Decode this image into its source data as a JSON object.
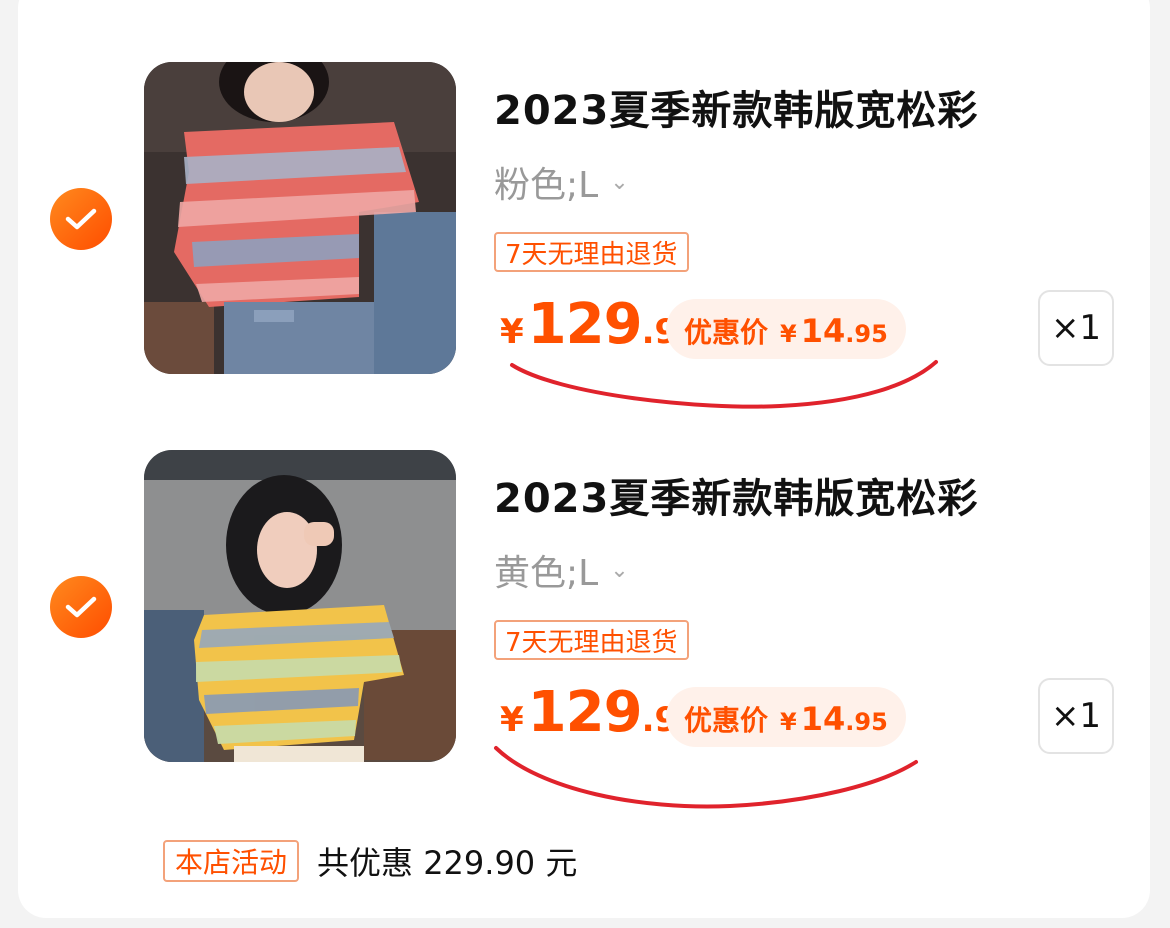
{
  "items": [
    {
      "title": "2023夏季新款韩版宽松彩",
      "variant": "粉色;L",
      "return_tag": "7天无理由退货",
      "price_symbol": "¥",
      "price_int": "129",
      "price_dec": ".9",
      "promo_label": "优惠价",
      "promo_symbol": "¥",
      "promo_int": "14",
      "promo_dec": ".95",
      "quantity": "×1",
      "selected": true,
      "stripe_colors": [
        "#e46a63",
        "#a9b2c6",
        "#f0a8a5",
        "#8fa0bd"
      ]
    },
    {
      "title": "2023夏季新款韩版宽松彩",
      "variant": "黄色;L",
      "return_tag": "7天无理由退货",
      "price_symbol": "¥",
      "price_int": "129",
      "price_dec": ".9",
      "promo_label": "优惠价",
      "promo_symbol": "¥",
      "promo_int": "14",
      "promo_dec": ".95",
      "quantity": "×1",
      "selected": true,
      "stripe_colors": [
        "#f2c34a",
        "#9aa9b6",
        "#c9dba6",
        "#8d9cb0"
      ]
    }
  ],
  "footer": {
    "tag": "本店活动",
    "text": "共优惠 229.90 元"
  },
  "colors": {
    "accent": "#ff5000",
    "check": "#ff6a00",
    "scribble": "#e0232c"
  }
}
